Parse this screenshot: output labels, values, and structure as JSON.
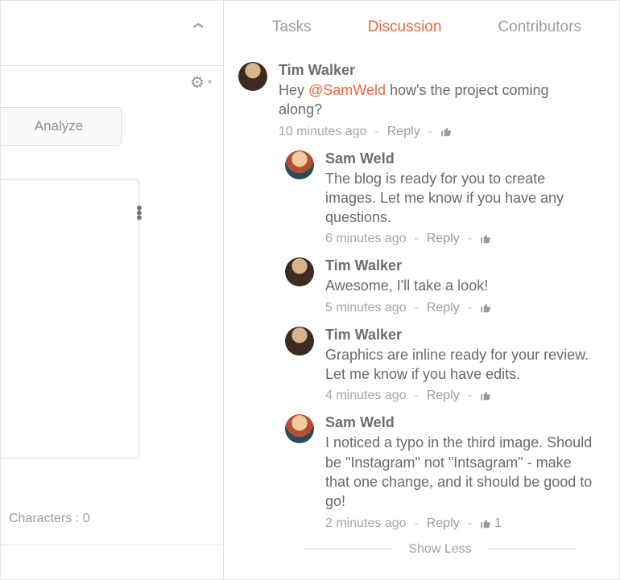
{
  "left": {
    "analyze_label": "Analyze",
    "char_label": "Characters :",
    "char_value": "0"
  },
  "tabs": {
    "tasks": "Tasks",
    "discussion": "Discussion",
    "contributors": "Contributors",
    "active": "discussion"
  },
  "reply_label": "Reply",
  "show_less": "Show Less",
  "thread": {
    "root": {
      "author": "Tim Walker",
      "avatar": "tim",
      "text_pre": "Hey ",
      "mention": "@SamWeld",
      "text_post": " how's the project coming along?",
      "time": "10 minutes ago",
      "likes": ""
    },
    "replies": [
      {
        "author": "Sam Weld",
        "avatar": "sam",
        "text": "The blog is ready for you to create images. Let me know if you have any questions.",
        "time": "6 minutes ago",
        "likes": ""
      },
      {
        "author": "Tim Walker",
        "avatar": "tim",
        "text": "Awesome, I'll take a look!",
        "time": "5 minutes ago",
        "likes": ""
      },
      {
        "author": "Tim Walker",
        "avatar": "tim",
        "text": "Graphics are inline ready for your review. Let me know if you have edits.",
        "time": "4 minutes ago",
        "likes": ""
      },
      {
        "author": "Sam Weld",
        "avatar": "sam",
        "text": "I noticed a typo in the third image. Should be \"Instagram\" not \"Intsagram\" - make that one change, and it should be good to go!",
        "time": "2 minutes ago",
        "likes": "1"
      }
    ]
  }
}
